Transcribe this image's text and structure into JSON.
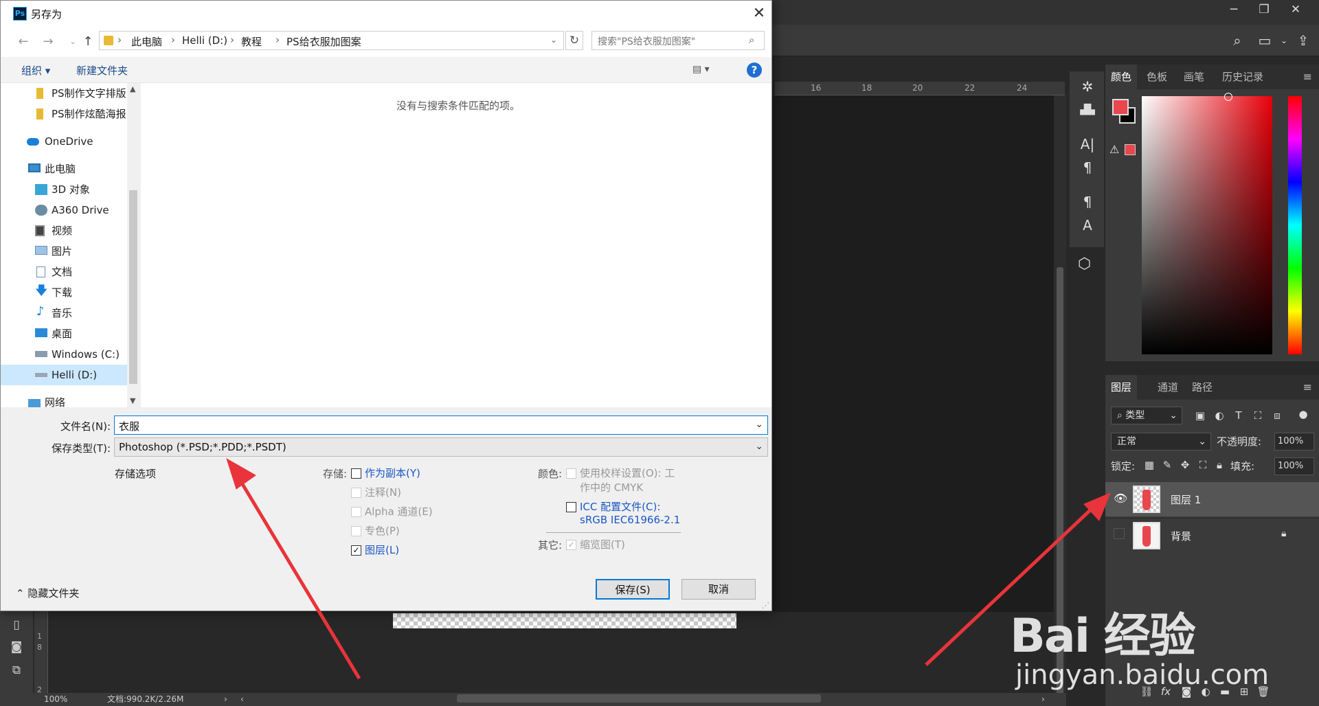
{
  "dialog": {
    "title": "另存为",
    "close_glyph": "✕",
    "address": {
      "segments": [
        "此电脑",
        "Helli (D:)",
        "教程",
        "PS给衣服加图案"
      ]
    },
    "search_placeholder": "搜索\"PS给衣服加图案\"",
    "commands": {
      "organize": "组织 ▾",
      "new_folder": "新建文件夹",
      "help": "?"
    },
    "nav_items": [
      {
        "label": "PS制作文字排版",
        "icon": "folder-icon"
      },
      {
        "label": "PS制作炫酷海报",
        "icon": "folder-icon"
      },
      {
        "label": "OneDrive",
        "icon": "cloud-icon"
      },
      {
        "label": "此电脑",
        "icon": "computer-icon"
      },
      {
        "label": "3D 对象",
        "icon": "cube-icon"
      },
      {
        "label": "A360 Drive",
        "icon": "drive-icon"
      },
      {
        "label": "视频",
        "icon": "video-icon"
      },
      {
        "label": "图片",
        "icon": "picture-icon"
      },
      {
        "label": "文档",
        "icon": "document-icon"
      },
      {
        "label": "下载",
        "icon": "download-icon"
      },
      {
        "label": "音乐",
        "icon": "music-icon"
      },
      {
        "label": "桌面",
        "icon": "desktop-icon"
      },
      {
        "label": "Windows (C:)",
        "icon": "disk-icon"
      },
      {
        "label": "Helli (D:)",
        "icon": "disk-icon"
      },
      {
        "label": "网络",
        "icon": "network-icon"
      }
    ],
    "empty_message": "没有与搜索条件匹配的项。",
    "filename_label": "文件名(N):",
    "filename_value": "衣服",
    "filetype_label": "保存类型(T):",
    "filetype_value": "Photoshop (*.PSD;*.PDD;*.PSDT)",
    "save_options_title": "存储选项",
    "storage_label": "存储:",
    "storage_options": [
      {
        "label": "作为副本(Y)",
        "checked": false,
        "enabled": true
      },
      {
        "label": "注释(N)",
        "checked": false,
        "enabled": false
      },
      {
        "label": "Alpha 通道(E)",
        "checked": false,
        "enabled": false
      },
      {
        "label": "专色(P)",
        "checked": false,
        "enabled": false
      },
      {
        "label": "图层(L)",
        "checked": true,
        "enabled": true
      }
    ],
    "color_label": "颜色:",
    "color_options": {
      "proof_line1": "使用校样设置(O):  工",
      "proof_line2": "作中的 CMYK",
      "icc_line1": "ICC 配置文件(C):",
      "icc_line2": "sRGB IEC61966-2.1"
    },
    "other_label": "其它:",
    "thumbnail_label": "缩览图(T)",
    "save_button": "保存(S)",
    "cancel_button": "取消",
    "hide_folders": "隐藏文件夹"
  },
  "photoshop": {
    "ruler_top": [
      "16",
      "18",
      "20",
      "22",
      "24"
    ],
    "ruler_left": [
      "1",
      "8",
      "2"
    ],
    "status_zoom": "100%",
    "status_doc": "文档:990.2K/2.26M",
    "color_tabs": [
      "颜色",
      "色板",
      "画笔",
      "历史记录"
    ],
    "layers_tabs": [
      "图层",
      "通道",
      "路径"
    ],
    "filter_kind": "类型",
    "blend_mode": "正常",
    "opacity_label": "不透明度:",
    "opacity_value": "100%",
    "lock_label": "锁定:",
    "fill_label": "填充:",
    "fill_value": "100%",
    "layers": [
      {
        "name": "图层 1",
        "visible": true,
        "selected": true
      },
      {
        "name": "背景",
        "visible": false,
        "selected": false,
        "locked": true
      }
    ],
    "foreground_color": "#e8474e",
    "background_color": "#000000"
  },
  "watermark": {
    "brand": "Bai 经验",
    "url": "jingyan.baidu.com"
  }
}
